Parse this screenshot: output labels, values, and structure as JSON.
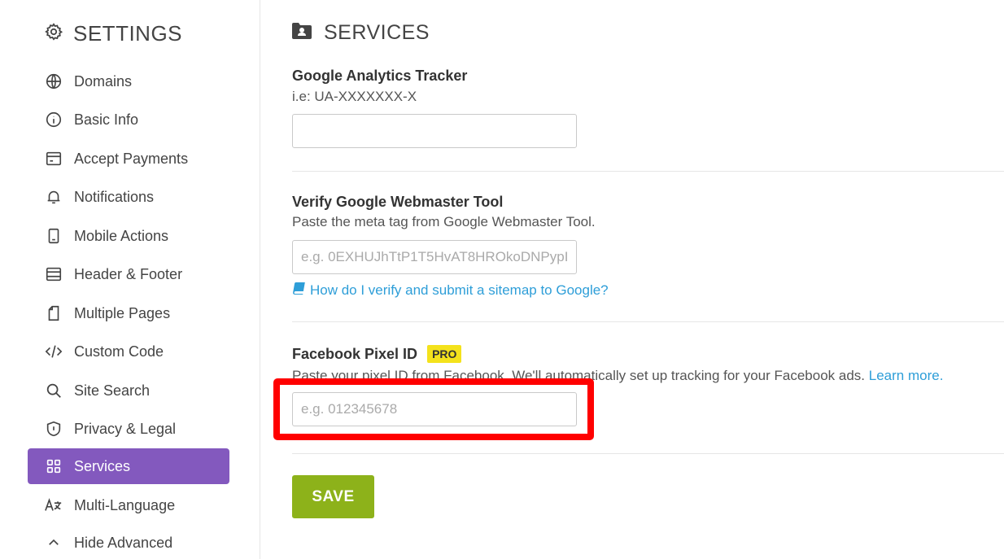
{
  "sidebar": {
    "title": "SETTINGS",
    "title_icon": "gear-icon",
    "items": [
      {
        "label": "Domains",
        "icon": "globe-icon",
        "active": false
      },
      {
        "label": "Basic Info",
        "icon": "info-icon",
        "active": false
      },
      {
        "label": "Accept Payments",
        "icon": "card-icon",
        "active": false
      },
      {
        "label": "Notifications",
        "icon": "bell-icon",
        "active": false
      },
      {
        "label": "Mobile Actions",
        "icon": "mobile-icon",
        "active": false
      },
      {
        "label": "Header & Footer",
        "icon": "layout-icon",
        "active": false
      },
      {
        "label": "Multiple Pages",
        "icon": "pages-icon",
        "active": false
      },
      {
        "label": "Custom Code",
        "icon": "code-icon",
        "active": false
      },
      {
        "label": "Site Search",
        "icon": "search-icon",
        "active": false
      },
      {
        "label": "Privacy & Legal",
        "icon": "shield-icon",
        "active": false
      },
      {
        "label": "Services",
        "icon": "grid-icon",
        "active": true
      },
      {
        "label": "Multi-Language",
        "icon": "translate-icon",
        "active": false
      },
      {
        "label": "Hide Advanced",
        "icon": "chevron-up-icon",
        "active": false
      }
    ],
    "active_color": "#8359be"
  },
  "main": {
    "title": "SERVICES",
    "title_icon": "contact-folder-icon",
    "google_analytics": {
      "label": "Google Analytics Tracker",
      "help": "i.e: UA-XXXXXXX-X",
      "value": "",
      "placeholder": ""
    },
    "webmaster": {
      "label": "Verify Google Webmaster Tool",
      "help": "Paste the meta tag from Google Webmaster Tool.",
      "placeholder": "e.g. 0EXHUJhTtP1T5HvAT8HROkoDNPypI",
      "link_text": "How do I verify and submit a sitemap to Google?",
      "link_icon": "book-icon"
    },
    "facebook_pixel": {
      "label": "Facebook Pixel ID",
      "badge": "PRO",
      "help": "Paste your pixel ID from Facebook. We'll automatically set up tracking for your Facebook ads.",
      "help_link": "Learn more.",
      "placeholder": "e.g. 012345678"
    },
    "save_label": "SAVE"
  },
  "colors": {
    "accent": "#8359be",
    "link": "#2e9ed8",
    "save": "#8db21a",
    "badge": "#f4e21c",
    "highlight": "#ff0000"
  }
}
